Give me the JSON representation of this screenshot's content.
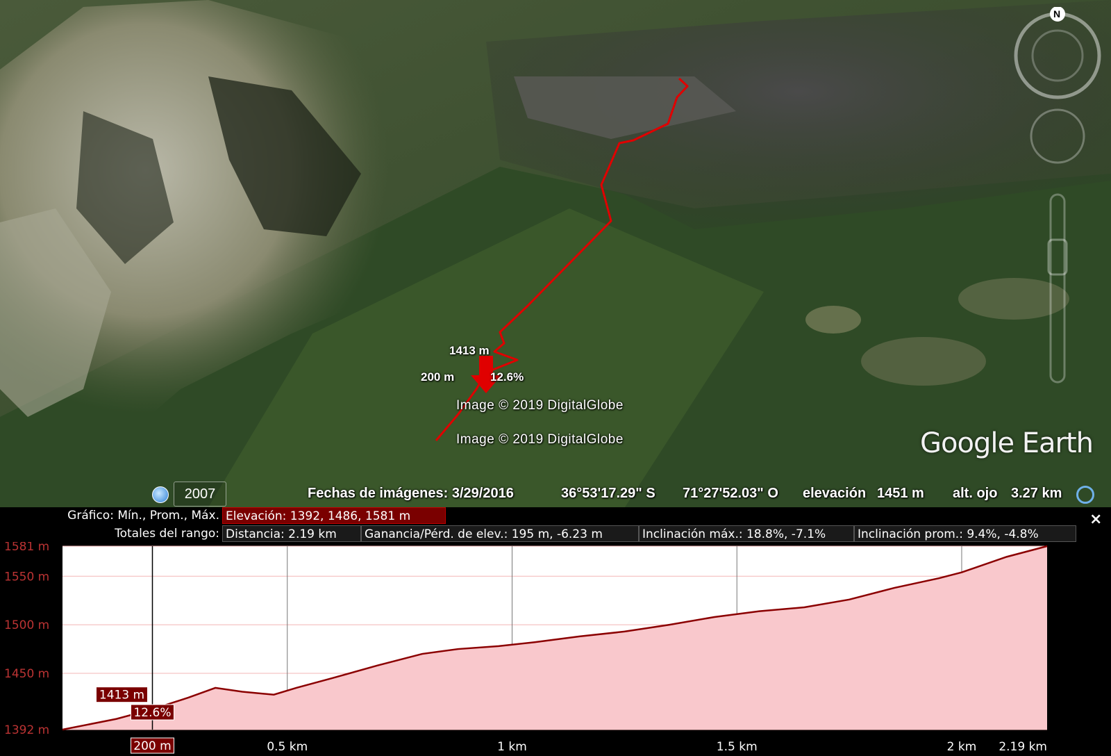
{
  "map": {
    "labels": {
      "elevation_marker": "1413 m",
      "distance_marker": "200 m",
      "slope_marker": "12.6%",
      "copyright_1": "Image © 2019 DigitalGlobe",
      "copyright_2": "Image © 2019 DigitalGlobe"
    },
    "logo": "Google Earth",
    "compass_north": "N",
    "track_color": "#e00000"
  },
  "status_bar": {
    "history_year": "2007",
    "imagery_date": "Fechas de imágenes: 3/29/2016",
    "latitude": "36°53'17.29\" S",
    "longitude": "71°27'52.03\" O",
    "elevation_label": "elevación",
    "elevation_value": "1451 m",
    "eye_alt_label": "alt. ojo",
    "eye_alt_value": "3.27 km"
  },
  "elevation_panel": {
    "close": "×",
    "graph_label": "Gráfico: Mín., Prom., Máx.",
    "graph_value": "Elevación: 1392, 1486, 1581 m",
    "totals_label": "Totales del rango:",
    "distance": "Distancia: 2.19 km",
    "gain_loss": "Ganancia/Pérd. de elev.: 195 m, -6.23 m",
    "max_slope": "Inclinación máx.: 18.8%, -7.1%",
    "avg_slope": "Inclinación prom.: 9.4%, -4.8%",
    "cursor": {
      "distance_label": "200 m",
      "elevation_label": "1413 m",
      "slope_label": "12.6%",
      "distance_km": 0.2,
      "elevation_m": 1413
    }
  },
  "chart_data": {
    "type": "area",
    "xlabel": "",
    "ylabel": "",
    "xlim": [
      0,
      2.19
    ],
    "ylim": [
      1392,
      1581
    ],
    "x_ticks": [
      "0.5 km",
      "1 km",
      "1.5 km",
      "2 km",
      "2.19 km"
    ],
    "x_tick_values": [
      0.5,
      1.0,
      1.5,
      2.0,
      2.19
    ],
    "y_ticks": [
      "1581 m",
      "1550 m",
      "1500 m",
      "1450 m",
      "1392 m"
    ],
    "y_tick_values": [
      1581,
      1550,
      1500,
      1450,
      1392
    ],
    "series": [
      {
        "x": [
          0,
          0.12,
          0.2,
          0.28,
          0.34,
          0.4,
          0.47,
          0.52,
          0.6,
          0.7,
          0.8,
          0.88,
          0.97,
          1.05,
          1.15,
          1.25,
          1.35,
          1.45,
          1.55,
          1.65,
          1.75,
          1.85,
          1.95,
          2.0,
          2.1,
          2.19
        ],
        "y": [
          1392,
          1403,
          1413,
          1425,
          1435,
          1431,
          1428,
          1435,
          1445,
          1458,
          1470,
          1475,
          1478,
          1482,
          1488,
          1493,
          1500,
          1508,
          1514,
          1518,
          1526,
          1538,
          1548,
          1554,
          1570,
          1581
        ]
      }
    ],
    "grid": true,
    "fill_color": "#f9c8cc",
    "line_color": "#8b0000"
  }
}
